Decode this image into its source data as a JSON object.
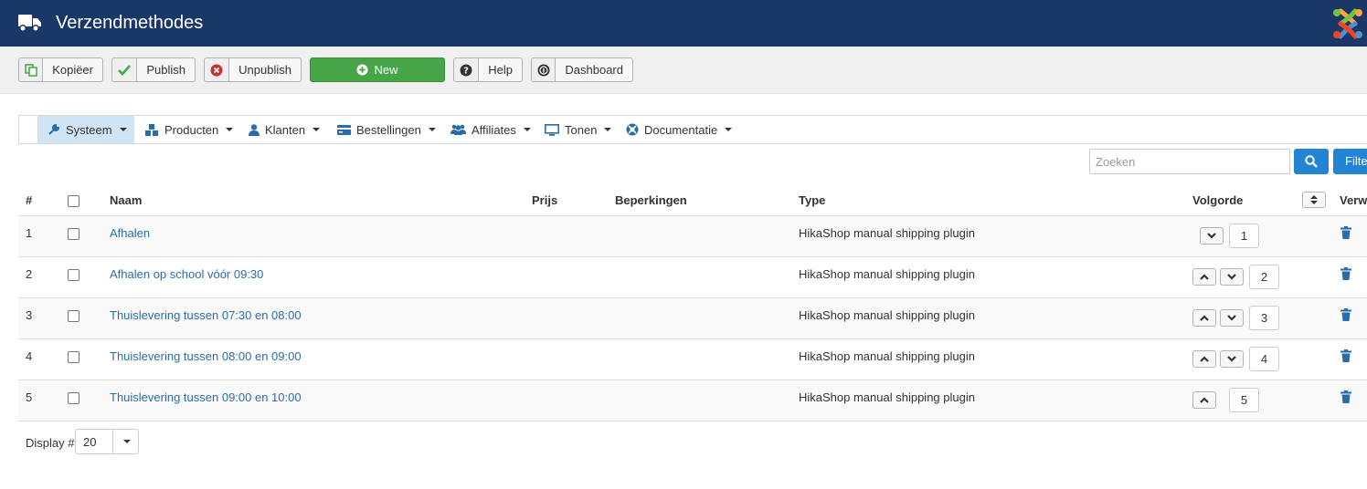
{
  "header": {
    "title": "Verzendmethodes",
    "truck_icon": "truck-icon",
    "logo": "joomla-logo"
  },
  "toolbar": {
    "copy_label": "Kopiëer",
    "publish_label": "Publish",
    "unpublish_label": "Unpublish",
    "new_label": "New",
    "help_label": "Help",
    "dashboard_label": "Dashboard"
  },
  "menu": {
    "items": [
      {
        "label": "Systeem",
        "icon": "wrench-icon"
      },
      {
        "label": "Producten",
        "icon": "cubes-icon"
      },
      {
        "label": "Klanten",
        "icon": "user-icon"
      },
      {
        "label": "Bestellingen",
        "icon": "credit-card-icon"
      },
      {
        "label": "Affiliates",
        "icon": "users-icon"
      },
      {
        "label": "Tonen",
        "icon": "monitor-icon"
      },
      {
        "label": "Documentatie",
        "icon": "lifebuoy-icon"
      }
    ]
  },
  "search": {
    "placeholder": "Zoeken",
    "filter_label": "Filte"
  },
  "table": {
    "headers": {
      "num": "#",
      "name": "Naam",
      "price": "Prijs",
      "restrictions": "Beperkingen",
      "type": "Type",
      "order": "Volgorde",
      "delete": "Verw"
    },
    "rows": [
      {
        "num": "1",
        "name": "Afhalen",
        "type": "HikaShop manual shipping plugin",
        "order": "1"
      },
      {
        "num": "2",
        "name": "Afhalen op school vóór 09:30",
        "type": "HikaShop manual shipping plugin",
        "order": "2"
      },
      {
        "num": "3",
        "name": "Thuislevering tussen 07:30 en 08:00",
        "type": "HikaShop manual shipping plugin",
        "order": "3"
      },
      {
        "num": "4",
        "name": "Thuislevering tussen 08:00 en 09:00",
        "type": "HikaShop manual shipping plugin",
        "order": "4"
      },
      {
        "num": "5",
        "name": "Thuislevering tussen 09:00 en 10:00",
        "type": "HikaShop manual shipping plugin",
        "order": "5"
      }
    ]
  },
  "footer": {
    "display_label": "Display #",
    "display_value": "20"
  },
  "colors": {
    "header_bg": "#1a3867",
    "new_button": "#46a546",
    "primary_button": "#2384d3",
    "link": "#2a6ca8",
    "active_menu": "#cfe5f6"
  }
}
